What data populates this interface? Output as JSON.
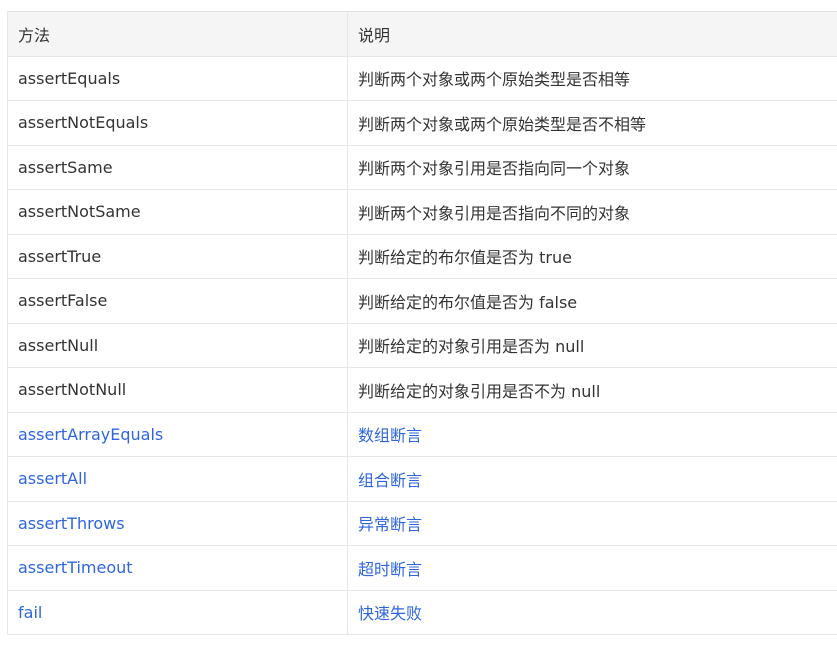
{
  "table": {
    "headers": [
      "方法",
      "说明"
    ],
    "rows": [
      {
        "method": "assertEquals",
        "description": "判断两个对象或两个原始类型是否相等",
        "link": false
      },
      {
        "method": "assertNotEquals",
        "description": "判断两个对象或两个原始类型是否不相等",
        "link": false
      },
      {
        "method": "assertSame",
        "description": "判断两个对象引用是否指向同一个对象",
        "link": false
      },
      {
        "method": "assertNotSame",
        "description": "判断两个对象引用是否指向不同的对象",
        "link": false
      },
      {
        "method": "assertTrue",
        "description": "判断给定的布尔值是否为 true",
        "link": false
      },
      {
        "method": "assertFalse",
        "description": "判断给定的布尔值是否为 false",
        "link": false
      },
      {
        "method": "assertNull",
        "description": "判断给定的对象引用是否为 null",
        "link": false
      },
      {
        "method": "assertNotNull",
        "description": "判断给定的对象引用是否不为 null",
        "link": false
      },
      {
        "method": "assertArrayEquals",
        "description": "数组断言",
        "link": true
      },
      {
        "method": "assertAll",
        "description": "组合断言",
        "link": true
      },
      {
        "method": "assertThrows",
        "description": "异常断言",
        "link": true
      },
      {
        "method": "assertTimeout",
        "description": "超时断言",
        "link": true
      },
      {
        "method": "fail",
        "description": "快速失败",
        "link": true
      }
    ]
  },
  "colors": {
    "text": "#333333",
    "link": "#2f66e0",
    "border": "#e6e6e6",
    "header_bg": "#f5f5f5"
  }
}
